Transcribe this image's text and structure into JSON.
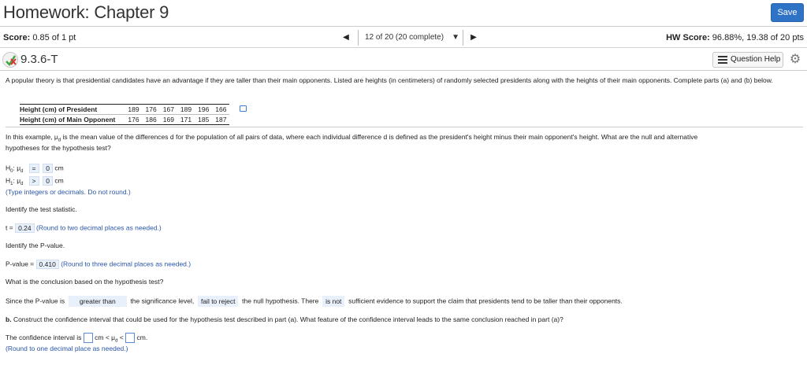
{
  "header": {
    "title": "Homework: Chapter 9",
    "save_label": "Save"
  },
  "score_bar": {
    "score_label": "Score:",
    "score_value": "0.85 of 1 pt",
    "nav_prev": "◀",
    "nav_next": "▶",
    "nav_caret": "▼",
    "nav_text": "12 of 20 (20 complete)",
    "hw_score_label": "HW Score:",
    "hw_score_value": "96.88%, 19.38 of 20 pts"
  },
  "question": {
    "number": "9.3.6-T",
    "help_label": "Question Help"
  },
  "content": {
    "intro": "A popular theory is that presidential candidates have an advantage if they are taller than their main opponents. Listed are heights (in centimeters) of randomly selected presidents along with the heights of their main opponents. Complete parts (a) and (b) below.",
    "table": {
      "rows": [
        {
          "label": "Height (cm) of President",
          "values": [
            "189",
            "176",
            "167",
            "189",
            "196",
            "166"
          ]
        },
        {
          "label": "Height (cm) of Main Opponent",
          "values": [
            "176",
            "186",
            "169",
            "171",
            "185",
            "187"
          ]
        }
      ]
    },
    "example_1": "In this example, μ",
    "example_sub": "d",
    "example_2": " is the mean value of the differences d for the population of all pairs of data, where each individual difference d is defined as the president's height minus their main opponent's height. What are the null and alternative",
    "example_3": "hypotheses for the hypothesis test?",
    "h0": {
      "prefix": "H",
      "prefix_sub": "0",
      "mu": ": μ",
      "mu_sub": "d",
      "op": "=",
      "value": "0",
      "unit": "cm"
    },
    "h1": {
      "prefix": "H",
      "prefix_sub": "1",
      "mu": ": μ",
      "mu_sub": "d",
      "op": ">",
      "value": "0",
      "unit": "cm"
    },
    "h_hint": "(Type integers or decimals. Do not round.)",
    "identify_stat": "Identify the test statistic.",
    "t_label": "t =",
    "t_value": "0.24",
    "t_hint": "(Round to two decimal places as needed.)",
    "identify_p": "Identify the P-value.",
    "p_label": "P-value =",
    "p_value": "0.410",
    "p_hint": "(Round to three decimal places as needed.)",
    "conclusion_q": "What is the conclusion based on the hypothesis test?",
    "since_1": "Since the P-value is",
    "since_sel_1": "greater than",
    "since_2": "the significance level,",
    "since_sel_2": "fail to reject",
    "since_3": "the null hypothesis. There",
    "since_sel_3": "is not",
    "since_4": "sufficient evidence to support the claim that presidents tend to be taller than their opponents.",
    "part_b_label": "b.",
    "part_b": "Construct the confidence interval that could be used for the hypothesis test described in part (a). What feature of the confidence interval leads to the same conclusion reached in part (a)?",
    "ci_1": "The confidence interval is",
    "ci_2": "cm < μ",
    "ci_sub": "d",
    "ci_3": " <",
    "ci_4": "cm.",
    "ci_hint": "(Round to one decimal place as needed.)"
  }
}
